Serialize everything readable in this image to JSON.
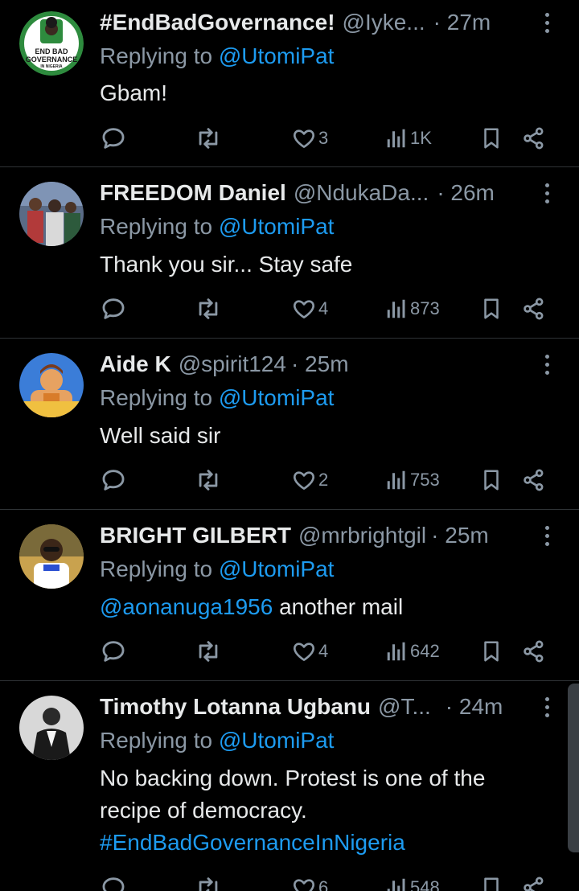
{
  "tweets": [
    {
      "name": "#EndBadGovernance!",
      "handle": "@Iyke...",
      "time": "· 27m",
      "replying_prefix": "Replying to ",
      "replying_to": "@UtomiPat",
      "text": "Gbam!",
      "likes": "3",
      "views": "1K",
      "avatar_text": [
        "END BAD",
        "GOVERNANCE",
        "IN NIGERIA"
      ]
    },
    {
      "name": "FREEDOM Daniel",
      "handle": "@NdukaDa...",
      "time": "· 26m",
      "replying_prefix": "Replying to ",
      "replying_to": "@UtomiPat",
      "text": "Thank you sir... Stay safe",
      "likes": "4",
      "views": "873"
    },
    {
      "name": "Aide K",
      "handle": "@spirit124",
      "time": "· 25m",
      "replying_prefix": "Replying to ",
      "replying_to": "@UtomiPat",
      "text": "Well said sir",
      "likes": "2",
      "views": "753"
    },
    {
      "name": "BRIGHT GILBERT",
      "handle": "@mrbrightgil",
      "time": "· 25m",
      "replying_prefix": "Replying to ",
      "replying_to": "@UtomiPat",
      "text_mention": "@aonanuga1956",
      "text": " another mail",
      "likes": "4",
      "views": "642"
    },
    {
      "name": "Timothy Lotanna Ugbanu",
      "handle": "@T...",
      "time": "· 24m",
      "replying_prefix": "Replying to ",
      "replying_to": "@UtomiPat",
      "text_line1": "No backing down. Protest is one of the",
      "text_line2": "recipe of democracy.",
      "hashtag": "#EndBadGovernanceInNigeria",
      "likes": "6",
      "views": "548"
    }
  ],
  "icons": {
    "reply": "reply-icon",
    "retweet": "retweet-icon",
    "like": "heart-icon",
    "views": "views-icon",
    "bookmark": "bookmark-icon",
    "share": "share-icon",
    "more": "more-icon"
  },
  "colors": {
    "background": "#000000",
    "text": "#e7e9ea",
    "secondary": "#8b98a5",
    "link": "#1d9bf0",
    "divider": "#2f3336"
  }
}
